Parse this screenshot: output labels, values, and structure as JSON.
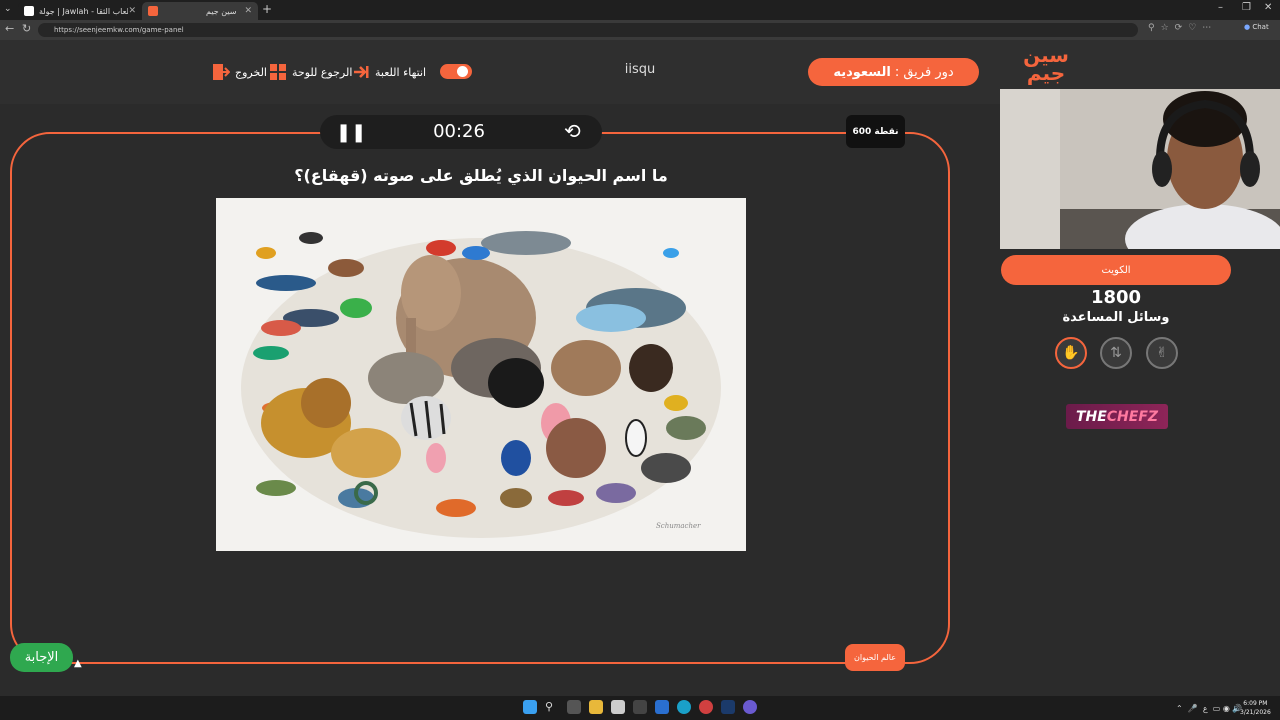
{
  "browser": {
    "tab1_title": "جولة | Jawlah - منصة الألعاب الثقا...",
    "tab2_title": "سين جيم",
    "url": "https://seenjeemkw.com/game-panel",
    "chat_label": "Chat"
  },
  "header": {
    "turn_label": "دور فريق :",
    "turn_team": "السعوديه",
    "logo_text": "سين جيم",
    "team_name": "iisqu",
    "end_game_label": "انتهاء اللعبة",
    "back_label": "الرجوع للوحة",
    "exit_label": "الخروج"
  },
  "game": {
    "timer": "00:26",
    "points": "600 نقطة",
    "question": "ما اسم الحيوان الذي يُطلق على صوته (قهقاع)؟",
    "category": "عالم الحيوان",
    "answer_label": "الإجابة",
    "image_alt": "animals collage",
    "image_signature": "Schumacher"
  },
  "right_panel": {
    "team_label": "الكويت",
    "score": "1800",
    "helpers_title": "وسائل المساعدة",
    "sponsor_left": "THE",
    "sponsor_right": "CHEFZ"
  },
  "taskbar": {
    "clock_time": "6:09 PM",
    "clock_date": "3/21/2026",
    "lang": "ع"
  },
  "colors": {
    "accent": "#f5653d",
    "answer_green": "#2fa84f",
    "bg": "#2b2b2b"
  },
  "icons": [
    "pause-icon",
    "reset-icon",
    "hand-icon",
    "swap-icon",
    "peace-icon",
    "exit-icon",
    "grid-icon",
    "arrow-icon"
  ]
}
